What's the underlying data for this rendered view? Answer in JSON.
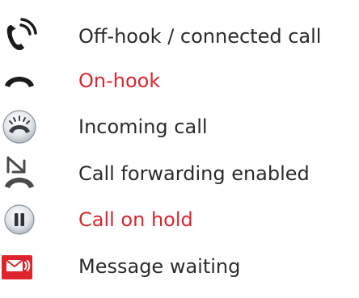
{
  "legend": {
    "items": [
      {
        "icon": "off-hook-handset-icon",
        "label": "Off-hook / connected call",
        "color": "#2b2b2b"
      },
      {
        "icon": "on-hook-handset-icon",
        "label": "On-hook",
        "color": "#d9262f"
      },
      {
        "icon": "incoming-call-icon",
        "label": "Incoming call",
        "color": "#2b2b2b"
      },
      {
        "icon": "call-forwarding-icon",
        "label": "Call forwarding enabled",
        "color": "#2b2b2b"
      },
      {
        "icon": "call-on-hold-icon",
        "label": "Call on hold",
        "color": "#d9262f"
      },
      {
        "icon": "message-waiting-icon",
        "label": "Message waiting",
        "color": "#2b2b2b"
      }
    ]
  },
  "colors": {
    "text_default": "#2b2b2b",
    "text_highlight": "#d9262f",
    "icon_dark": "#1b1b1b",
    "message_red": "#e0242c"
  }
}
